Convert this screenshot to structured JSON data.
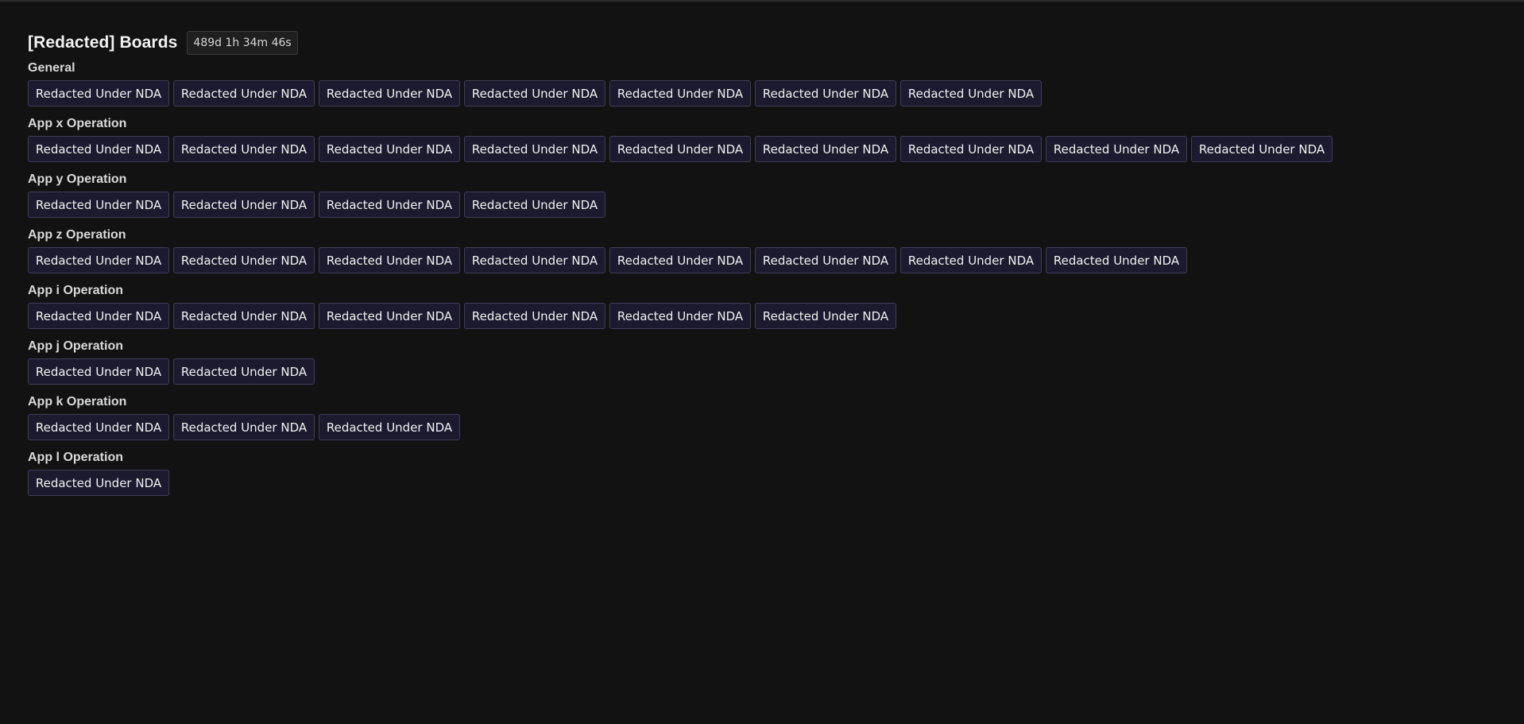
{
  "header": {
    "title": "[Redacted] Boards",
    "timer": "489d 1h 34m 46s"
  },
  "sections": [
    {
      "title": "General",
      "buttons": [
        "Redacted Under NDA",
        "Redacted Under NDA",
        "Redacted Under NDA",
        "Redacted Under NDA",
        "Redacted Under NDA",
        "Redacted Under NDA",
        "Redacted Under NDA"
      ]
    },
    {
      "title": "App x Operation",
      "buttons": [
        "Redacted Under NDA",
        "Redacted Under NDA",
        "Redacted Under NDA",
        "Redacted Under NDA",
        "Redacted Under NDA",
        "Redacted Under NDA",
        "Redacted Under NDA",
        "Redacted Under NDA",
        "Redacted Under NDA"
      ]
    },
    {
      "title": "App y Operation",
      "buttons": [
        "Redacted Under NDA",
        "Redacted Under NDA",
        "Redacted Under NDA",
        "Redacted Under NDA"
      ]
    },
    {
      "title": "App z Operation",
      "buttons": [
        "Redacted Under NDA",
        "Redacted Under NDA",
        "Redacted Under NDA",
        "Redacted Under NDA",
        "Redacted Under NDA",
        "Redacted Under NDA",
        "Redacted Under NDA",
        "Redacted Under NDA"
      ]
    },
    {
      "title": "App i Operation",
      "buttons": [
        "Redacted Under NDA",
        "Redacted Under NDA",
        "Redacted Under NDA",
        "Redacted Under NDA",
        "Redacted Under NDA",
        "Redacted Under NDA"
      ]
    },
    {
      "title": "App j Operation",
      "buttons": [
        "Redacted Under NDA",
        "Redacted Under NDA"
      ]
    },
    {
      "title": "App k Operation",
      "buttons": [
        "Redacted Under NDA",
        "Redacted Under NDA",
        "Redacted Under NDA"
      ]
    },
    {
      "title": "App l Operation",
      "buttons": [
        "Redacted Under NDA"
      ]
    }
  ],
  "colors": {
    "background": "#121212",
    "button_background": "#1b1a2e",
    "button_border": "#3f3e57",
    "text": "#f2f2f2"
  }
}
